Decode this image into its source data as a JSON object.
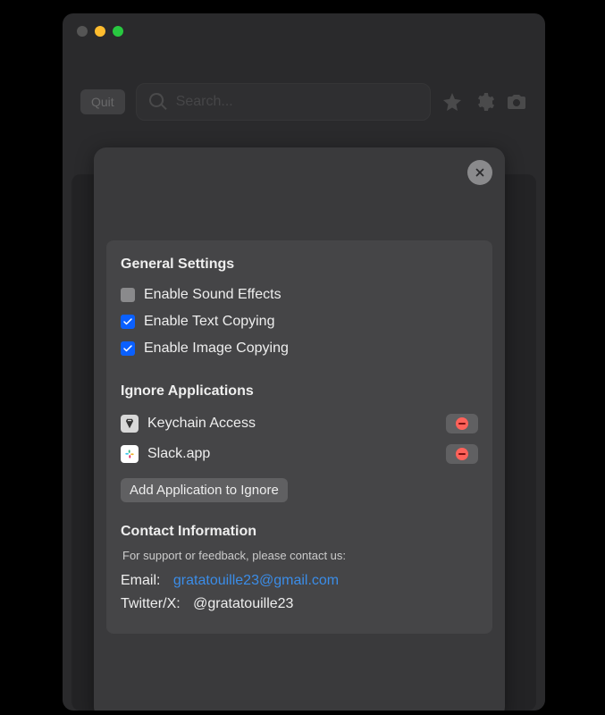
{
  "toolbar": {
    "quit_label": "Quit",
    "search_placeholder": "Search..."
  },
  "settings": {
    "general_title": "General Settings",
    "options": [
      {
        "label": "Enable Sound Effects",
        "checked": false
      },
      {
        "label": "Enable Text Copying",
        "checked": true
      },
      {
        "label": "Enable Image Copying",
        "checked": true
      }
    ],
    "ignore_title": "Ignore Applications",
    "ignored_apps": [
      {
        "name": "Keychain Access",
        "icon": "keychain"
      },
      {
        "name": "Slack.app",
        "icon": "slack"
      }
    ],
    "add_button_label": "Add Application to Ignore",
    "contact_title": "Contact Information",
    "contact_subtitle": "For support or feedback, please contact us:",
    "email_label": "Email:",
    "email_value": "gratatouille23@gmail.com",
    "twitter_label": "Twitter/X:",
    "twitter_value": "@gratatouille23"
  }
}
